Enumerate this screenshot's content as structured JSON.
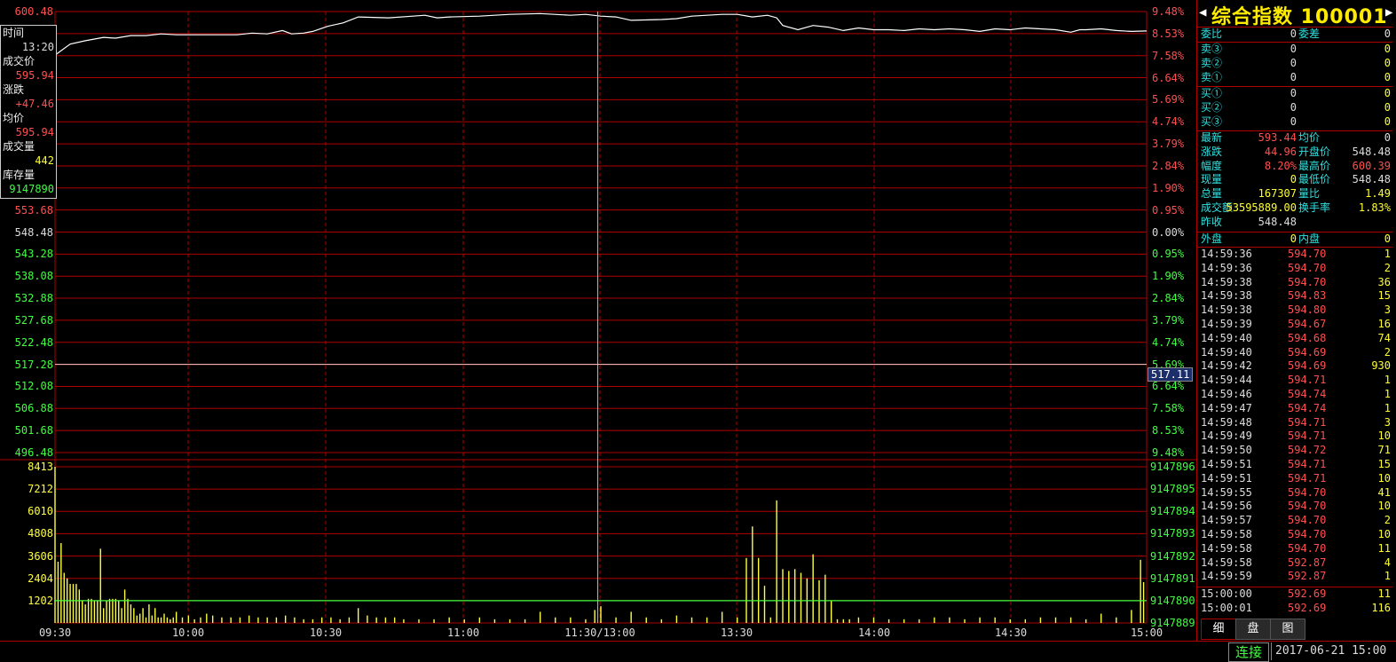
{
  "colors": {
    "grid": "#b00000",
    "price_line": "#ffffff",
    "volume_bar": "#ffff40",
    "baseline": "#40ff40",
    "crosshair": "#ffffff",
    "up": "#ff5050",
    "down": "#40ff40",
    "label_cyan": "#30e0e0"
  },
  "chart_data": {
    "type": "line",
    "title": "",
    "price_axis": {
      "ticks": [
        "600.48",
        "553.68",
        "548.48",
        "543.28",
        "538.08",
        "532.88",
        "527.68",
        "522.48",
        "517.28",
        "512.08",
        "506.88",
        "501.68",
        "496.48"
      ],
      "ylim": [
        496.48,
        600.48
      ],
      "base": 548.48
    },
    "percent_axis": {
      "ticks": [
        "9.48%",
        "8.53%",
        "7.58%",
        "6.64%",
        "5.69%",
        "4.74%",
        "3.79%",
        "2.84%",
        "1.90%",
        "0.95%",
        "0.00%",
        "0.95%",
        "1.90%",
        "2.84%",
        "3.79%",
        "4.74%",
        "5.69%",
        "6.64%",
        "7.58%",
        "8.53%",
        "9.48%"
      ]
    },
    "x_ticks": [
      "09:30",
      "10:00",
      "10:30",
      "11:00",
      "11:30/13:00",
      "13:30",
      "14:00",
      "14:30",
      "15:00"
    ],
    "price_series": {
      "name": "",
      "x": [
        0,
        5,
        10,
        16,
        20,
        25,
        30,
        35,
        40,
        48,
        60,
        65,
        70,
        75,
        78,
        82,
        85,
        90,
        95,
        100,
        110,
        118,
        122,
        126,
        130,
        140,
        150,
        160,
        170,
        175,
        180,
        185,
        190,
        200,
        205,
        210,
        215,
        220,
        225,
        230,
        235,
        238,
        240,
        245,
        250,
        255,
        260,
        265,
        270,
        275,
        280,
        285,
        290,
        295,
        300,
        305,
        310,
        315,
        320,
        325,
        330,
        335,
        338,
        340,
        345,
        350,
        355,
        360
      ],
      "values": [
        590.2,
        592.8,
        593.6,
        594.4,
        594.2,
        594.8,
        594.8,
        595.2,
        595.0,
        595.0,
        595.0,
        595.4,
        595.2,
        596.0,
        595.2,
        595.4,
        595.8,
        597.0,
        597.8,
        599.2,
        599.0,
        599.4,
        599.6,
        599.0,
        599.2,
        599.4,
        599.8,
        600.0,
        599.6,
        599.8,
        599.4,
        599.2,
        598.4,
        598.6,
        598.8,
        599.4,
        599.6,
        599.8,
        599.8,
        599.2,
        599.6,
        599.0,
        597.2,
        596.2,
        597.2,
        596.8,
        596.0,
        596.6,
        596.2,
        596.2,
        596.0,
        596.4,
        596.2,
        596.4,
        596.2,
        595.8,
        596.4,
        596.2,
        596.6,
        596.4,
        596.2,
        595.6,
        596.2,
        596.2,
        596.4,
        596.0,
        595.8,
        595.9
      ]
    },
    "crosshair": {
      "x_minute": 179,
      "price": 517.28,
      "label": "517.11"
    },
    "volume_axis": {
      "ticks": [
        "8413",
        "7212",
        "6010",
        "4808",
        "3606",
        "2404",
        "1202"
      ],
      "ymax": 8413,
      "baseline": 1202,
      "right_ticks": [
        "9147896",
        "9147895",
        "9147894",
        "9147893",
        "9147892",
        "9147891",
        "9147890",
        "9147889"
      ]
    },
    "volume_series": {
      "name": "",
      "x": [
        0,
        1,
        2,
        3,
        4,
        5,
        6,
        7,
        8,
        9,
        10,
        11,
        12,
        13,
        14,
        15,
        16,
        17,
        18,
        19,
        20,
        21,
        22,
        23,
        24,
        25,
        26,
        27,
        28,
        29,
        30,
        31,
        32,
        33,
        34,
        35,
        36,
        37,
        38,
        39,
        40,
        42,
        44,
        46,
        48,
        50,
        52,
        55,
        58,
        61,
        64,
        67,
        70,
        73,
        76,
        79,
        82,
        85,
        88,
        91,
        94,
        97,
        100,
        103,
        106,
        109,
        112,
        115,
        120,
        125,
        130,
        135,
        140,
        145,
        150,
        155,
        160,
        165,
        170,
        175,
        178,
        180,
        185,
        190,
        195,
        200,
        205,
        210,
        215,
        220,
        225,
        228,
        230,
        232,
        234,
        236,
        238,
        240,
        242,
        244,
        246,
        248,
        250,
        252,
        254,
        256,
        258,
        260,
        262,
        265,
        270,
        275,
        280,
        285,
        290,
        295,
        300,
        305,
        310,
        315,
        320,
        325,
        330,
        335,
        340,
        345,
        350,
        355,
        358,
        359
      ],
      "values": [
        8413,
        3300,
        4300,
        2700,
        2400,
        2100,
        2100,
        2100,
        1800,
        1200,
        1000,
        1300,
        1300,
        1200,
        1200,
        4000,
        800,
        1200,
        1300,
        1300,
        1300,
        1200,
        800,
        1800,
        1300,
        1000,
        800,
        400,
        500,
        800,
        300,
        1000,
        400,
        800,
        300,
        300,
        500,
        300,
        200,
        300,
        600,
        300,
        400,
        200,
        300,
        500,
        400,
        300,
        300,
        300,
        400,
        300,
        300,
        300,
        400,
        300,
        200,
        200,
        300,
        300,
        200,
        300,
        800,
        400,
        300,
        300,
        300,
        200,
        200,
        200,
        300,
        200,
        300,
        200,
        200,
        200,
        600,
        300,
        300,
        200,
        700,
        900,
        300,
        600,
        300,
        200,
        400,
        300,
        300,
        600,
        300,
        3500,
        5200,
        3500,
        2000,
        300,
        6600,
        2900,
        2800,
        2900,
        2700,
        2400,
        3700,
        2300,
        2600,
        1200,
        200,
        200,
        200,
        300,
        300,
        200,
        200,
        200,
        300,
        300,
        200,
        300,
        300,
        200,
        200,
        300,
        300,
        300,
        200,
        500,
        300,
        700,
        3400,
        2200
      ]
    }
  },
  "infobox": {
    "time_label": "时间",
    "time_value": "13:20",
    "price_label": "成交价",
    "price_value": "595.94",
    "change_label": "涨跌",
    "change_value": "+47.46",
    "avg_label": "均价",
    "avg_value": "595.94",
    "vol_label": "成交量",
    "vol_value": "442",
    "stock_label": "库存量",
    "stock_value": "9147890"
  },
  "header": {
    "title": "综合指数 100001",
    "prev_arrow": "◀",
    "next_arrow": "▶"
  },
  "ratio": {
    "label_wb": "委比",
    "val_wb": "0",
    "label_wc": "委差",
    "val_wc": "0"
  },
  "sell": [
    {
      "label": "卖③",
      "price": "0",
      "vol": "0"
    },
    {
      "label": "卖②",
      "price": "0",
      "vol": "0"
    },
    {
      "label": "卖①",
      "price": "0",
      "vol": "0"
    }
  ],
  "buy": [
    {
      "label": "买①",
      "price": "0",
      "vol": "0"
    },
    {
      "label": "买②",
      "price": "0",
      "vol": "0"
    },
    {
      "label": "买③",
      "price": "0",
      "vol": "0"
    }
  ],
  "stats": [
    {
      "l1": "最新",
      "v1": "593.44",
      "l2": "均价",
      "v2": "0",
      "c1": "red",
      "c2": "wht"
    },
    {
      "l1": "涨跌",
      "v1": "44.96",
      "l2": "开盘价",
      "v2": "548.48",
      "c1": "red",
      "c2": "wht"
    },
    {
      "l1": "幅度",
      "v1": "8.20%",
      "l2": "最高价",
      "v2": "600.39",
      "c1": "red",
      "c2": "red"
    },
    {
      "l1": "现量",
      "v1": "0",
      "l2": "最低价",
      "v2": "548.48",
      "c1": "yel",
      "c2": "wht"
    },
    {
      "l1": "总量",
      "v1": "167307",
      "l2": "量比",
      "v2": "1.49",
      "c1": "yel",
      "c2": "yel"
    },
    {
      "l1": "成交额",
      "v1": "53595889.00",
      "l2": "换手率",
      "v2": "1.83%",
      "c1": "yel",
      "c2": "yel"
    },
    {
      "l1": "昨收",
      "v1": "548.48",
      "l2": "",
      "v2": "",
      "c1": "wht",
      "c2": "wht"
    }
  ],
  "outer": {
    "label_out": "外盘",
    "val_out": "0",
    "label_in": "内盘",
    "val_in": "0"
  },
  "ticks": [
    {
      "t": "14:59:36",
      "p": "594.70",
      "v": "1"
    },
    {
      "t": "14:59:36",
      "p": "594.70",
      "v": "2"
    },
    {
      "t": "14:59:38",
      "p": "594.70",
      "v": "36"
    },
    {
      "t": "14:59:38",
      "p": "594.83",
      "v": "15"
    },
    {
      "t": "14:59:38",
      "p": "594.80",
      "v": "3"
    },
    {
      "t": "14:59:39",
      "p": "594.67",
      "v": "16"
    },
    {
      "t": "14:59:40",
      "p": "594.68",
      "v": "74"
    },
    {
      "t": "14:59:40",
      "p": "594.69",
      "v": "2"
    },
    {
      "t": "14:59:42",
      "p": "594.69",
      "v": "930"
    },
    {
      "t": "14:59:44",
      "p": "594.71",
      "v": "1"
    },
    {
      "t": "14:59:46",
      "p": "594.74",
      "v": "1"
    },
    {
      "t": "14:59:47",
      "p": "594.74",
      "v": "1"
    },
    {
      "t": "14:59:48",
      "p": "594.71",
      "v": "3"
    },
    {
      "t": "14:59:49",
      "p": "594.71",
      "v": "10"
    },
    {
      "t": "14:59:50",
      "p": "594.72",
      "v": "71"
    },
    {
      "t": "14:59:51",
      "p": "594.71",
      "v": "15"
    },
    {
      "t": "14:59:51",
      "p": "594.71",
      "v": "10"
    },
    {
      "t": "14:59:55",
      "p": "594.70",
      "v": "41"
    },
    {
      "t": "14:59:56",
      "p": "594.70",
      "v": "10"
    },
    {
      "t": "14:59:57",
      "p": "594.70",
      "v": "2"
    },
    {
      "t": "14:59:58",
      "p": "594.70",
      "v": "10"
    },
    {
      "t": "14:59:58",
      "p": "594.70",
      "v": "11"
    },
    {
      "t": "14:59:58",
      "p": "592.87",
      "v": "4"
    },
    {
      "t": "14:59:59",
      "p": "592.87",
      "v": "1"
    }
  ],
  "ticks_after": [
    {
      "t": "15:00:00",
      "p": "592.69",
      "v": "11"
    },
    {
      "t": "15:00:01",
      "p": "592.69",
      "v": "116"
    }
  ],
  "tabs": [
    "细",
    "盘",
    "图"
  ],
  "status": {
    "connection": "连接",
    "datetime": "2017-06-21 15:00"
  }
}
